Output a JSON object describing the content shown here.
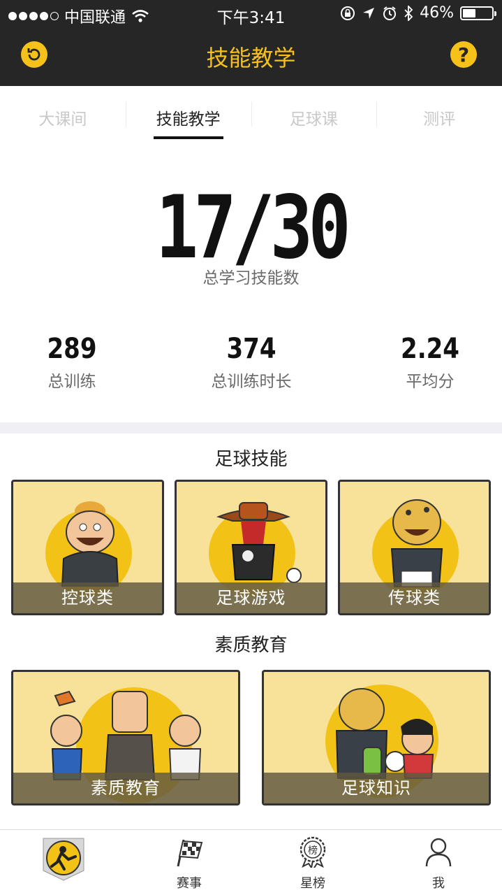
{
  "status_bar": {
    "carrier": "中国联通",
    "time": "下午3:41",
    "battery": "46%",
    "battery_level": 0.46
  },
  "nav": {
    "title": "技能教学",
    "help_label": "?"
  },
  "tabs": [
    {
      "label": "大课间",
      "active": false
    },
    {
      "label": "技能教学",
      "active": true
    },
    {
      "label": "足球课",
      "active": false
    },
    {
      "label": "测评",
      "active": false
    }
  ],
  "summary": {
    "skills_learned": "17/30",
    "skills_label": "总学习技能数",
    "stats": [
      {
        "value": "289",
        "label": "总训练"
      },
      {
        "value": "374",
        "label": "总训练时长"
      },
      {
        "value": "2.24",
        "label": "平均分"
      }
    ]
  },
  "football_skills": {
    "title": "足球技能",
    "cards": [
      {
        "label": "控球类"
      },
      {
        "label": "足球游戏"
      },
      {
        "label": "传球类"
      }
    ]
  },
  "quality_education": {
    "title": "素质教育",
    "cards": [
      {
        "label": "素质教育"
      },
      {
        "label": "足球知识"
      }
    ]
  },
  "bottom_nav": [
    {
      "label": "",
      "icon": "football-player-icon"
    },
    {
      "label": "赛事",
      "icon": "checkered-flag-icon"
    },
    {
      "label": "星榜",
      "icon": "ranking-badge-icon",
      "badge_char": "榜"
    },
    {
      "label": "我",
      "icon": "user-icon"
    }
  ],
  "colors": {
    "accent": "#f6c21a",
    "header_bg": "#262626",
    "card_bg": "#f8e29a",
    "card_circle": "#f2c316"
  }
}
